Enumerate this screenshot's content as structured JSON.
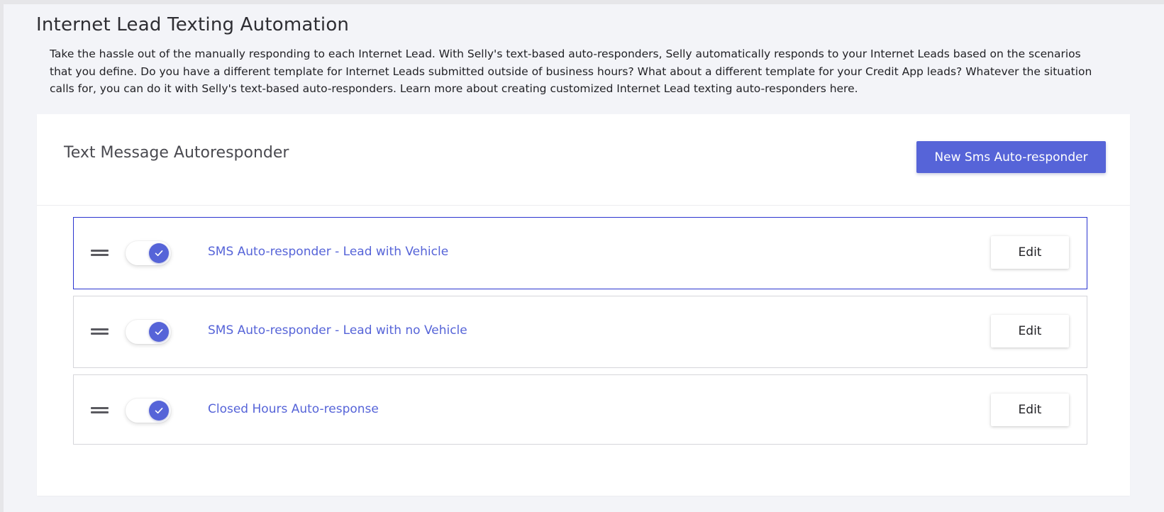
{
  "page": {
    "title": "Internet Lead Texting Automation",
    "description": "Take the hassle out of the manually responding to each Internet Lead. With Selly's text-based auto-responders, Selly automatically responds to your Internet Leads based on the scenarios that you define. Do you have a different template for Internet Leads submitted outside of business hours? What about a different template for your Credit App leads? Whatever the situation calls for, you can do it with Selly's text-based auto-responders. Learn more about creating customized Internet Lead texting auto-responders here."
  },
  "card": {
    "title": "Text Message Autoresponder",
    "new_button_label": "New Sms Auto-responder"
  },
  "autoresponders": [
    {
      "name": "SMS Auto-responder - Lead with Vehicle",
      "enabled": true,
      "selected": true,
      "edit_label": "Edit"
    },
    {
      "name": "SMS Auto-responder - Lead with no Vehicle",
      "enabled": true,
      "selected": false,
      "edit_label": "Edit"
    },
    {
      "name": "Closed Hours Auto-response",
      "enabled": true,
      "selected": false,
      "edit_label": "Edit"
    }
  ],
  "icons": {
    "drag_handle": "drag-handle-icon",
    "toggle_knob": "check-icon"
  },
  "colors": {
    "accent": "#5664d8",
    "selected_border": "#2a34d0",
    "page_background": "#f3f4f8"
  }
}
